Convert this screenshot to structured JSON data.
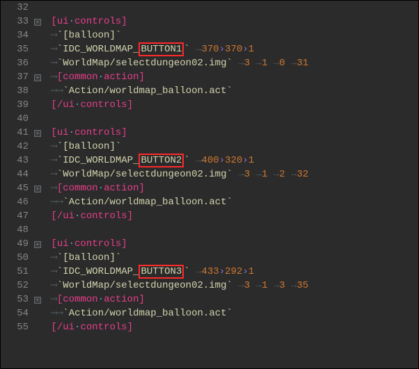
{
  "lines": {
    "32": "32",
    "33": "33",
    "34": "34",
    "35": "35",
    "36": "36",
    "37": "37",
    "38": "38",
    "39": "39",
    "40": "40",
    "41": "41",
    "42": "42",
    "43": "43",
    "44": "44",
    "45": "45",
    "46": "46",
    "47": "47",
    "48": "48",
    "49": "49",
    "50": "50",
    "51": "51",
    "52": "52",
    "53": "53",
    "54": "54",
    "55": "55"
  },
  "tokens": {
    "ui_open_l": "[",
    "ui_open_t": "ui",
    "ui_open_dot": "·",
    "ui_open_c": "controls",
    "ui_open_r": "]",
    "ui_close_l": "[",
    "ui_close_s": "/",
    "ui_close_t": "ui",
    "ui_close_dot": "·",
    "ui_close_c": "controls",
    "ui_close_r": "]",
    "common_l": "[",
    "common_t": "common",
    "common_dot": "·",
    "common_a": "action",
    "common_r": "]",
    "balloon_tick": "`",
    "balloon": "[balloon]",
    "idc_pre": "IDC_WORLDMAP_",
    "btn1": "BUTTON1",
    "btn2": "BUTTON2",
    "btn3": "BUTTON3",
    "worldmap": "WorldMap/selectdungeon02.img",
    "action": "Action/worldmap_balloon.act",
    "n370": "370",
    "n1": "1",
    "n3": "3",
    "n0": "0",
    "n31": "31",
    "n400": "400",
    "n320": "320",
    "n2": "2",
    "n32": "32",
    "n433": "433",
    "n292": "292",
    "n35": "35"
  },
  "glyphs": {
    "arrow": "→",
    "raquo": "›",
    "tab_arrow": "⟶"
  }
}
